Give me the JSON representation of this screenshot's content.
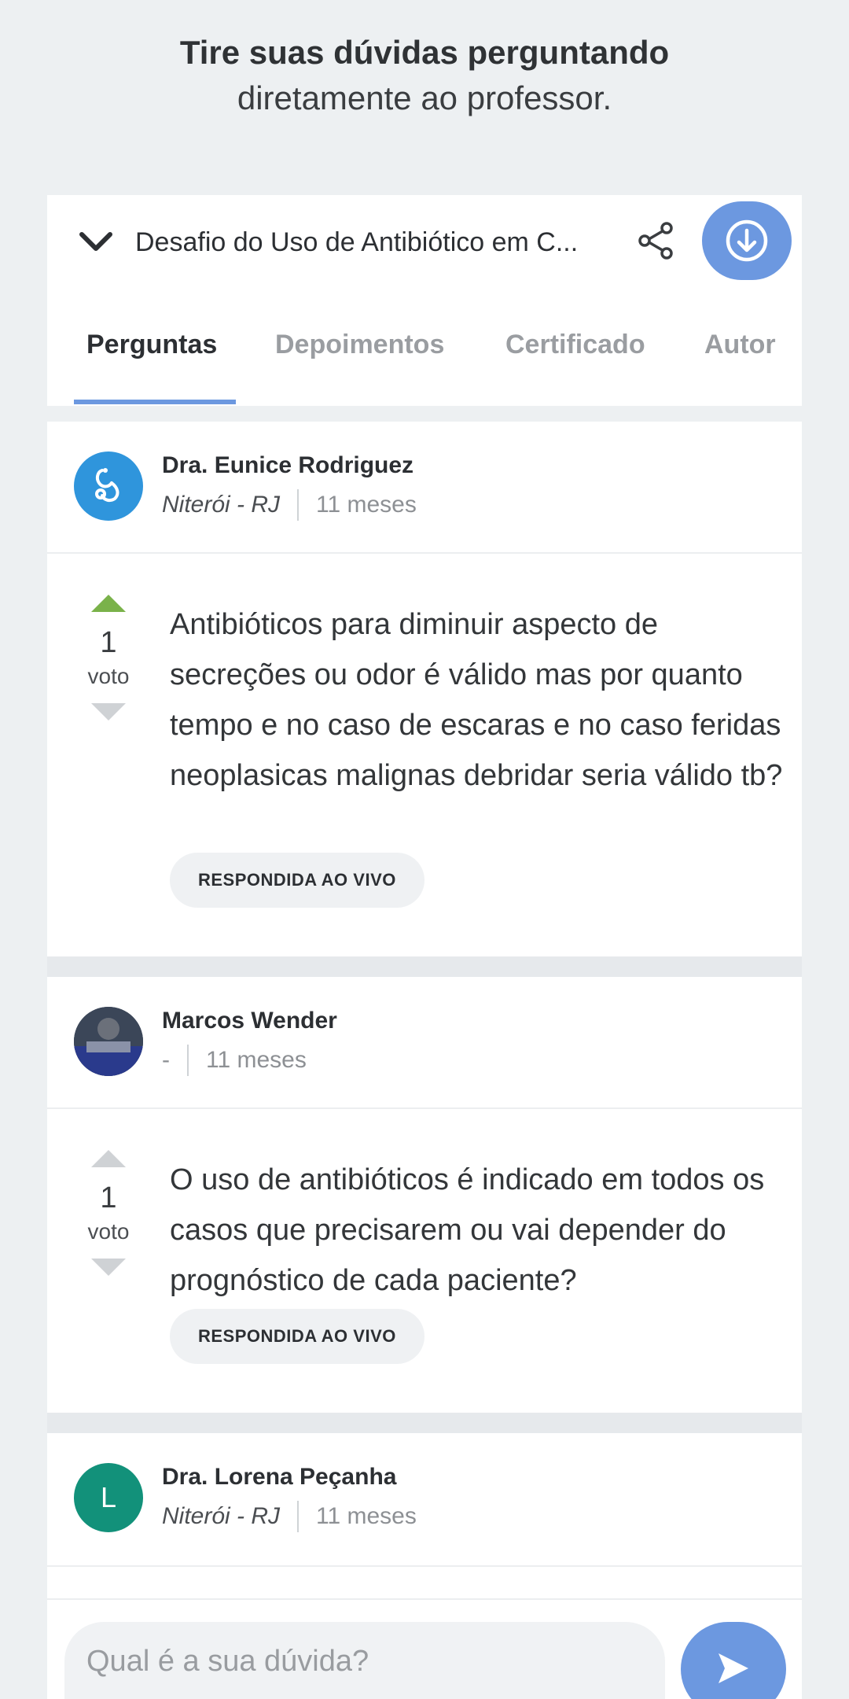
{
  "promo": {
    "title": "Tire suas dúvidas perguntando",
    "subtitle": "diretamente ao professor."
  },
  "header": {
    "course_title": "Desafio do Uso de Antibiótico em C...",
    "tabs": [
      "Perguntas",
      "Depoimentos",
      "Certificado",
      "Autor"
    ],
    "active_tab": "Perguntas"
  },
  "questions": [
    {
      "author": "Dra. Eunice Rodriguez",
      "location": "Niterói - RJ",
      "time": "11 meses",
      "votes": "1",
      "vote_label": "voto",
      "upvoted": true,
      "text": "Antibióticos para diminuir aspecto de secreções ou odor é válido mas por quanto tempo e no caso de escaras e no caso feridas neoplasicas malignas debridar seria válido tb?",
      "badge": "RESPONDIDA AO VIVO"
    },
    {
      "author": "Marcos Wender",
      "location": "-",
      "time": "11 meses",
      "votes": "1",
      "vote_label": "voto",
      "upvoted": false,
      "text": "O uso de antibióticos é indicado em todos os casos que precisarem ou vai depender do prognóstico de cada paciente?",
      "badge": "RESPONDIDA AO VIVO"
    },
    {
      "author": "Dra. Lorena Peçanha",
      "location": "Niterói - RJ",
      "time": "11 meses",
      "avatar_letter": "L"
    }
  ],
  "composer": {
    "placeholder": "Qual é a sua dúvida?"
  },
  "colors": {
    "accent": "#6c98e0",
    "upvote": "#7ab24a",
    "avatar_teal": "#12917a",
    "avatar_blue": "#2f95dc"
  },
  "icons": [
    "chevron-down-icon",
    "share-icon",
    "download-icon",
    "stethoscope-icon",
    "arrow-up-icon",
    "arrow-down-icon",
    "send-icon"
  ]
}
